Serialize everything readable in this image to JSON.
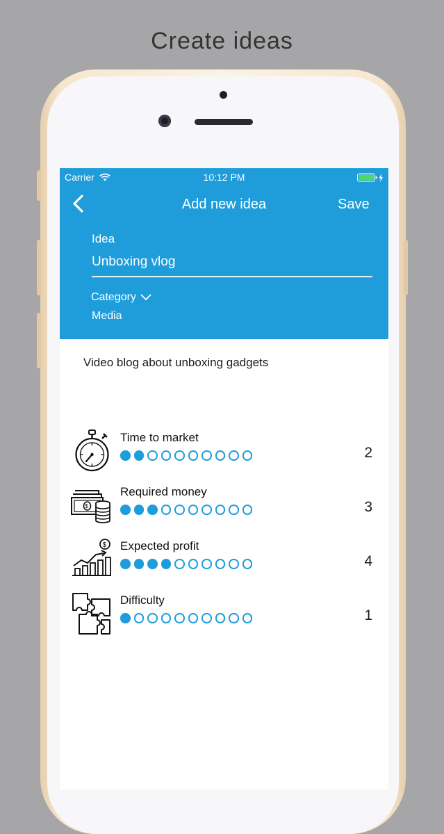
{
  "caption": "Create ideas",
  "status_bar": {
    "carrier": "Carrier",
    "time": "10:12 PM"
  },
  "nav": {
    "title": "Add new idea",
    "save_label": "Save"
  },
  "form": {
    "idea_label": "Idea",
    "idea_value": "Unboxing vlog",
    "category_label": "Category",
    "category_value": "Media"
  },
  "description": "Video blog about unboxing gadgets",
  "metrics": [
    {
      "label": "Time to market",
      "value": "2",
      "filled": 2,
      "total": 10,
      "icon": "stopwatch-icon"
    },
    {
      "label": "Required money",
      "value": "3",
      "filled": 3,
      "total": 10,
      "icon": "money-stack-icon"
    },
    {
      "label": "Expected profit",
      "value": "4",
      "filled": 4,
      "total": 10,
      "icon": "growth-chart-icon"
    },
    {
      "label": "Difficulty",
      "value": "1",
      "filled": 1,
      "total": 10,
      "icon": "puzzle-icon"
    }
  ],
  "colors": {
    "accent": "#1f9ddb",
    "background": "#a6a5a7",
    "phone_gold": "#f6e7cf"
  }
}
